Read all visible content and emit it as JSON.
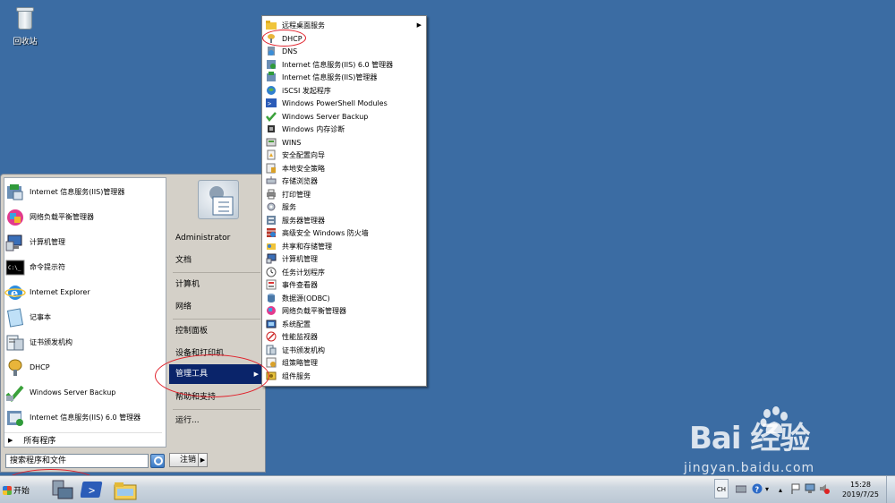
{
  "desktop": {
    "recycle_bin_label": "回收站"
  },
  "start_menu": {
    "pinned": [
      {
        "label": "Internet 信息服务(IIS)管理器",
        "icon": "iis-manager-icon"
      },
      {
        "label": "网络负载平衡管理器",
        "icon": "nlb-manager-icon"
      },
      {
        "label": "计算机管理",
        "icon": "computer-management-icon"
      },
      {
        "label": "命令提示符",
        "icon": "command-prompt-icon"
      },
      {
        "label": "Internet Explorer",
        "icon": "internet-explorer-icon"
      },
      {
        "label": "记事本",
        "icon": "notepad-icon"
      },
      {
        "label": "证书颁发机构",
        "icon": "certificate-authority-icon"
      },
      {
        "label": "DHCP",
        "icon": "dhcp-icon"
      },
      {
        "label": "Windows Server Backup",
        "icon": "server-backup-icon"
      },
      {
        "label": "Internet 信息服务(IIS) 6.0 管理器",
        "icon": "iis6-manager-icon"
      }
    ],
    "all_programs": "所有程序",
    "search_placeholder": "搜索程序和文件",
    "right": {
      "user": "Administrator",
      "documents": "文档",
      "computer": "计算机",
      "network": "网络",
      "control_panel": "控制面板",
      "devices_printers": "设备和打印机",
      "admin_tools": "管理工具",
      "help_support": "帮助和支持",
      "run": "运行..."
    },
    "logoff": "注销"
  },
  "admin_tools_menu": {
    "items": [
      {
        "label": "远程桌面服务",
        "has_submenu": true
      },
      {
        "label": "DHCP"
      },
      {
        "label": "DNS"
      },
      {
        "label": "Internet 信息服务(IIS) 6.0 管理器"
      },
      {
        "label": "Internet 信息服务(IIS)管理器"
      },
      {
        "label": "iSCSI 发起程序"
      },
      {
        "label": "Windows PowerShell Modules"
      },
      {
        "label": "Windows Server Backup"
      },
      {
        "label": "Windows 内存诊断"
      },
      {
        "label": "WINS"
      },
      {
        "label": "安全配置向导"
      },
      {
        "label": "本地安全策略"
      },
      {
        "label": "存储浏览器"
      },
      {
        "label": "打印管理"
      },
      {
        "label": "服务"
      },
      {
        "label": "服务器管理器"
      },
      {
        "label": "高级安全 Windows 防火墙"
      },
      {
        "label": "共享和存储管理"
      },
      {
        "label": "计算机管理"
      },
      {
        "label": "任务计划程序"
      },
      {
        "label": "事件查看器"
      },
      {
        "label": "数据源(ODBC)"
      },
      {
        "label": "网络负载平衡管理器"
      },
      {
        "label": "系统配置"
      },
      {
        "label": "性能监视器"
      },
      {
        "label": "证书颁发机构"
      },
      {
        "label": "组策略管理"
      },
      {
        "label": "组件服务"
      }
    ]
  },
  "taskbar": {
    "start_label": "开始",
    "lang": "CH",
    "time": "15:28",
    "date": "2019/7/25"
  },
  "watermark": {
    "brand": "Bai  经验",
    "url": "jingyan.baidu.com"
  },
  "colors": {
    "desktop": "#3b6ca3",
    "highlight": "#0a246a",
    "annotation": "#e0202a"
  }
}
